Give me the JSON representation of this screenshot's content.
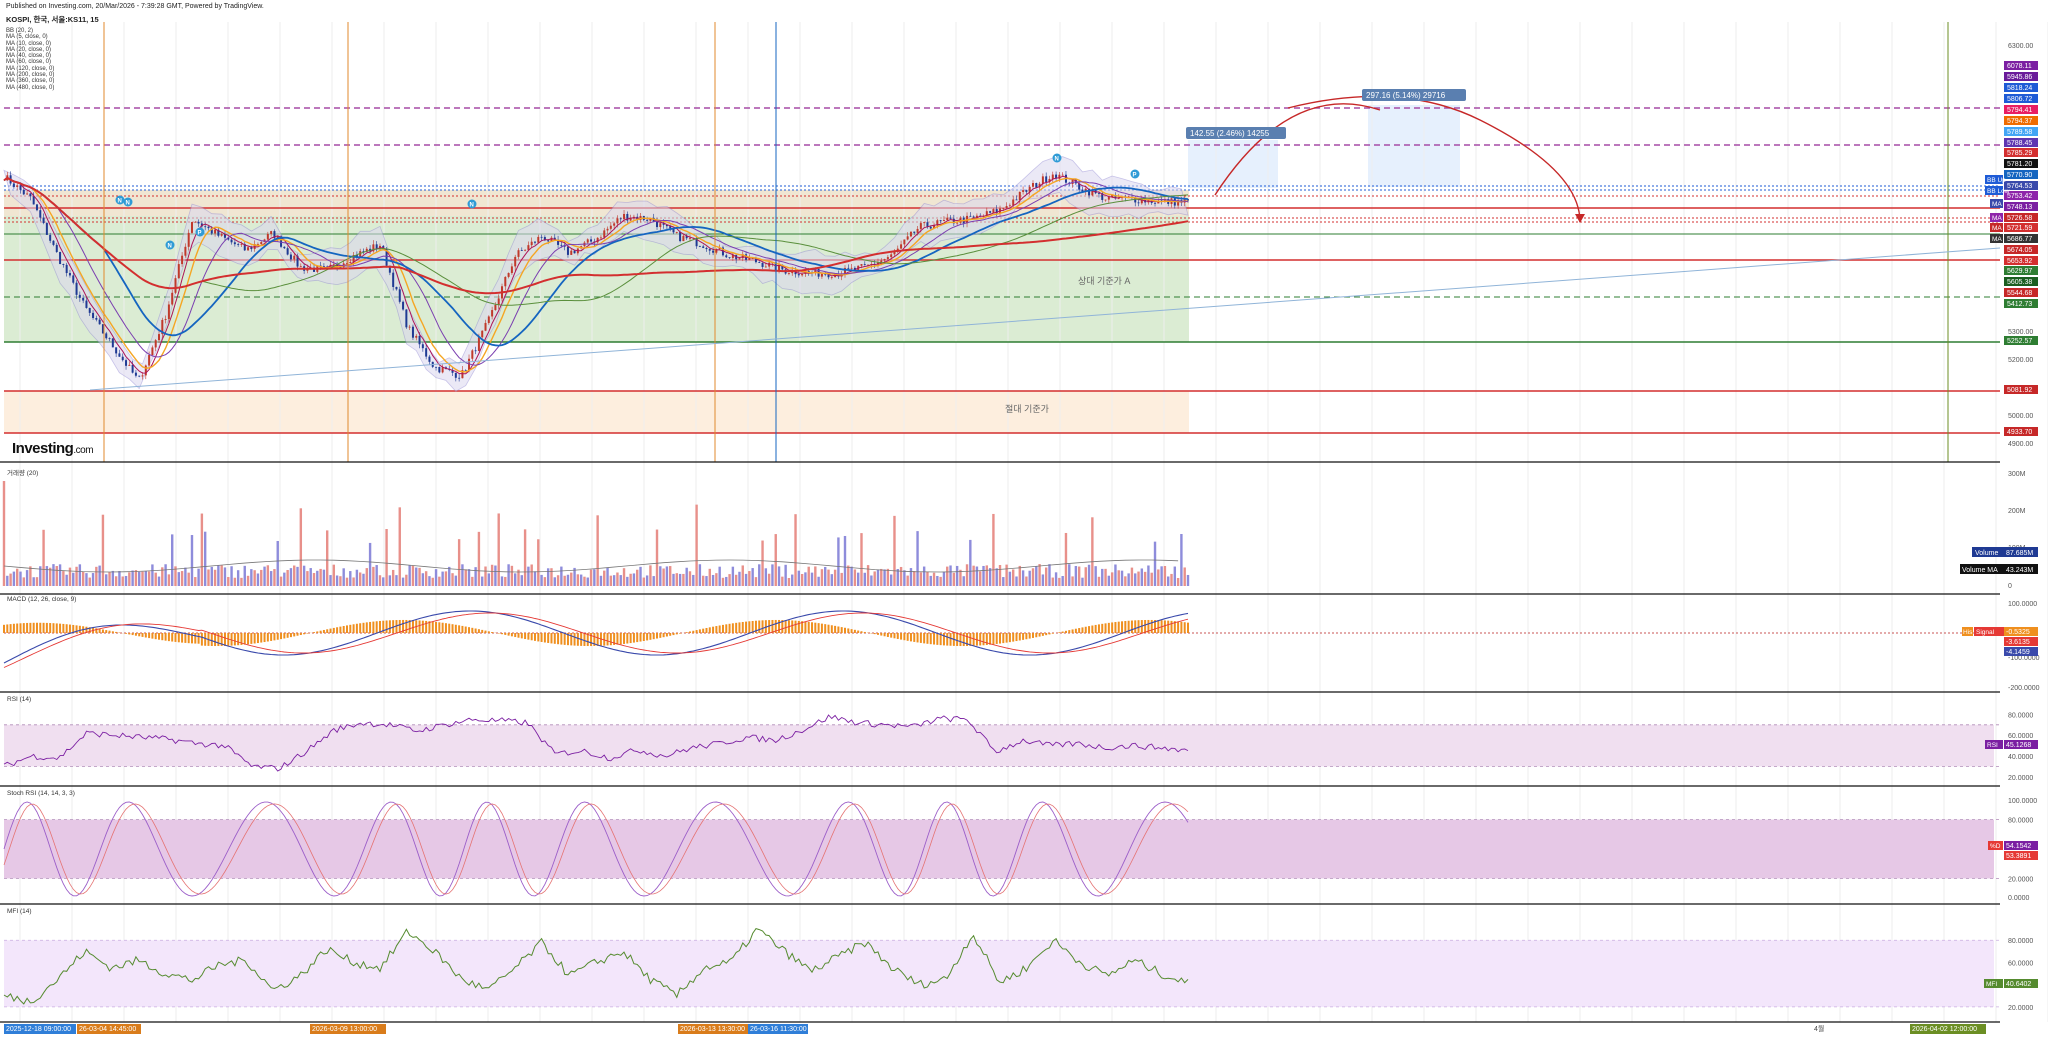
{
  "header": {
    "published": "Published on Investing.com, 20/Mar/2026 - 7:39:28 GMT, Powered by TradingView.",
    "symbol": "KOSPI, 한국, 서울:KS11, 15"
  },
  "indicators": [
    "BB (20, 2)",
    "MA (5, close, 0)",
    "MA (10, close, 0)",
    "MA (20, close, 0)",
    "MA (40, close, 0)",
    "MA (60, close, 0)",
    "MA (120, close, 0)",
    "MA (200, close, 0)",
    "MA (360, close, 0)",
    "MA (480, close, 0)"
  ],
  "logo": {
    "main": "Investing",
    "suffix": ".com"
  },
  "colors": {
    "up": "#e8908a",
    "down": "#8e8cdb",
    "ma_blue": "#1565c0",
    "ma_red": "#d32f2f",
    "ma_orange": "#f5a623",
    "green_zone": "#cfe5c4",
    "orange_zone": "#fdeede",
    "bb_fill": "#dcd8f0"
  },
  "chart_data": [
    {
      "type": "line",
      "pane": "price",
      "title": "KOSPI, 한국, 서울:KS11, 15",
      "y_ticks": [
        "6300.00",
        "5300.00",
        "5200.00",
        "5000.00",
        "4900.00"
      ],
      "ylim": [
        4890,
        6330
      ],
      "series": [
        {
          "values": [
            5840,
            5760,
            5560,
            5380,
            5250,
            5120,
            5350,
            5690,
            5630,
            5580,
            5640,
            5520,
            5510,
            5560,
            5600,
            5310,
            5170,
            5140,
            5330,
            5560,
            5630,
            5570,
            5620,
            5700,
            5690,
            5630,
            5600,
            5560,
            5540,
            5510,
            5500,
            5500,
            5520,
            5560,
            5660,
            5680,
            5690,
            5720,
            5790,
            5850,
            5800,
            5760,
            5760,
            5750,
            5750
          ]
        }
      ],
      "price_labels": [
        "6078.11",
        "5945.86",
        "5818.24",
        "5806.72",
        "5794.41",
        "5794.37",
        "5789.58",
        "5788.45",
        "5785.29",
        "5781.20",
        "5770.90",
        "5764.53",
        "5753.42",
        "5748.13",
        "5726.58",
        "5721.59",
        "5686.77",
        "5674.05",
        "5653.92",
        "5629.97",
        "5605.38",
        "5544.68",
        "5412.73",
        "5252.57",
        "5081.92",
        "4933.70"
      ],
      "tags": [
        "BB Up",
        "BB Low",
        "MA",
        "MA",
        "MA",
        "MA"
      ],
      "annotations": [
        "상대 기준가 A",
        "절대 기준가",
        "142.55 (2.46%) 14255",
        "297.16 (5.14%) 29716"
      ],
      "markers": [
        "N",
        "N",
        "N",
        "P",
        "N",
        "N",
        "P"
      ]
    },
    {
      "type": "bar",
      "pane": "volume",
      "title": "거래량 (20)",
      "y_ticks": [
        "300M",
        "200M",
        "100M",
        "0"
      ],
      "labels": {
        "volume": "Volume",
        "volume_value": "87.685M",
        "ma": "Volume MA",
        "ma_value": "43.243M"
      }
    },
    {
      "type": "line",
      "pane": "macd",
      "title": "MACD (12, 26, close, 9)",
      "y_ticks": [
        "100.0000",
        "0",
        "-100.0000",
        "-200.0000"
      ],
      "labels": {
        "hist": "His",
        "signal": "Signal",
        "v1": "-0.5325",
        "v2": "-3.6135",
        "v3": "-4.1459"
      }
    },
    {
      "type": "line",
      "pane": "rsi",
      "title": "RSI (14)",
      "y_ticks": [
        "80.0000",
        "60.0000",
        "40.0000",
        "20.0000"
      ],
      "ylim": [
        15,
        90
      ],
      "values": [
        30,
        40,
        38,
        62,
        60,
        58,
        56,
        52,
        50,
        30,
        28,
        45,
        65,
        72,
        70,
        64,
        70,
        75,
        74,
        72,
        42,
        45,
        38,
        46,
        40,
        48,
        52,
        58,
        55,
        65,
        78,
        72,
        70,
        68,
        76,
        75,
        44,
        55,
        50,
        52,
        48,
        50,
        48,
        45
      ],
      "labels": {
        "name": "RSI",
        "value": "45.1268"
      }
    },
    {
      "type": "line",
      "pane": "stochrsi",
      "title": "Stoch RSI (14, 14, 3, 3)",
      "y_ticks": [
        "100.0000",
        "80.0000",
        "20.0000",
        "0.0000"
      ],
      "ylim": [
        0,
        100
      ],
      "labels": {
        "name": "%D",
        "v1": "54.1542",
        "v2": "53.3891"
      }
    },
    {
      "type": "line",
      "pane": "mfi",
      "title": "MFI (14)",
      "y_ticks": [
        "80.0000",
        "60.0000",
        "20.0000"
      ],
      "ylim": [
        10,
        100
      ],
      "values": [
        30,
        25,
        45,
        70,
        55,
        62,
        50,
        44,
        58,
        62,
        35,
        48,
        72,
        60,
        55,
        88,
        70,
        45,
        35,
        55,
        78,
        48,
        60,
        70,
        45,
        30,
        55,
        60,
        90,
        70,
        52,
        65,
        78,
        55,
        40,
        45,
        86,
        42,
        55,
        80,
        60,
        48,
        62,
        50,
        41
      ],
      "labels": {
        "name": "MFI",
        "value": "40.6402"
      }
    }
  ],
  "x_axis": {
    "labels": [
      "2025-12-18 09:00:00",
      "26-03-04 14:45:00",
      "2026-03-09 13:00:00",
      "2026-03-13 13:30:00",
      "26-03-16 11:30:00",
      "4월",
      "2026-04-02 12:00:00"
    ]
  }
}
